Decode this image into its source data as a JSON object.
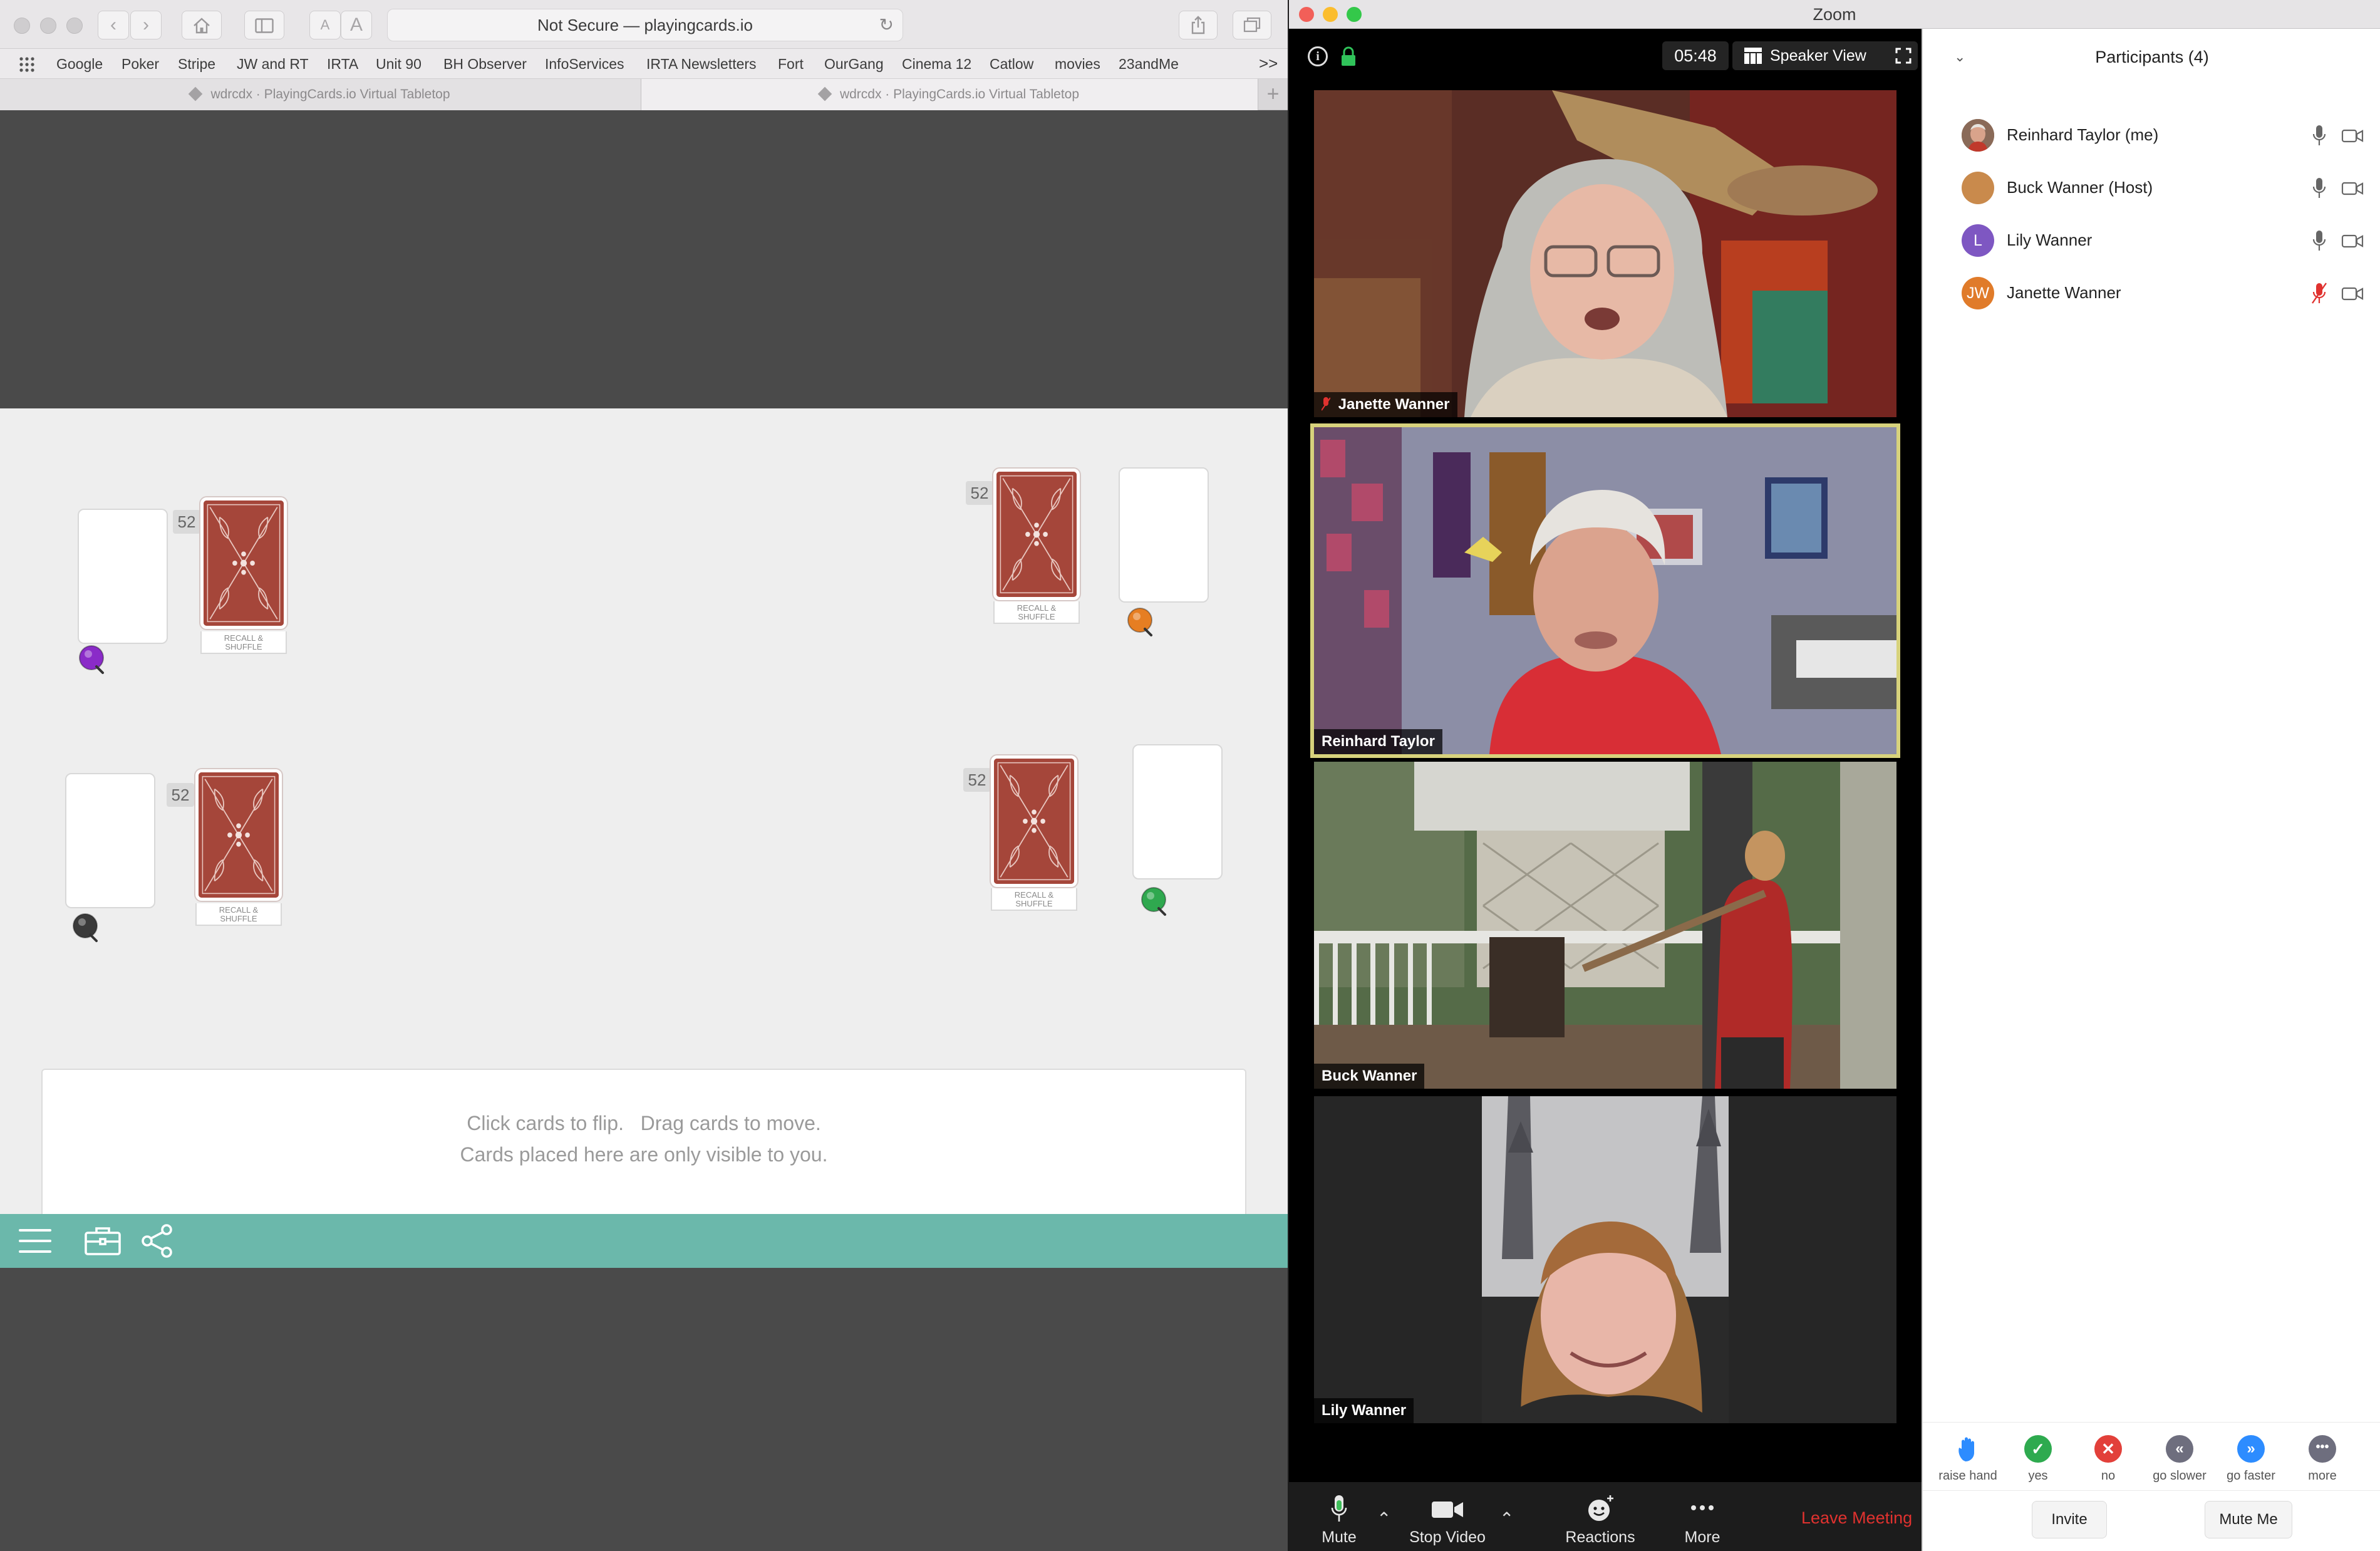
{
  "safari": {
    "address": "Not Secure — playingcards.io",
    "bookmarks": [
      "Google",
      "Poker",
      "Stripe",
      "JW and RT",
      "IRTA",
      "Unit 90",
      "BH Observer",
      "InfoServices",
      "IRTA Newsletters",
      "Fort",
      "OurGang",
      "Cinema 12",
      "Catlow",
      "movies",
      "23andMe"
    ],
    "more_bookmarks": ">>",
    "tabs": [
      {
        "label": "wdrcdx · PlayingCards.io Virtual Tabletop"
      },
      {
        "label": "wdrcdx · PlayingCards.io Virtual Tabletop"
      }
    ],
    "new_tab": "+"
  },
  "tabletop": {
    "decks": [
      {
        "count": "52",
        "recall_line1": "RECALL &",
        "recall_line2": "SHUFFLE"
      },
      {
        "count": "52",
        "recall_line1": "RECALL &",
        "recall_line2": "SHUFFLE"
      },
      {
        "count": "52",
        "recall_line1": "RECALL &",
        "recall_line2": "SHUFFLE"
      },
      {
        "count": "52",
        "recall_line1": "RECALL &",
        "recall_line2": "SHUFFLE"
      }
    ],
    "player_colors": {
      "purple": "#8a2bc8",
      "orange": "#e67e22",
      "dark": "#3a3a3a",
      "green": "#2fa84f"
    },
    "card_back_color": "#a5463a",
    "hand_line1": "Click cards to flip.   Drag cards to move.",
    "hand_line2": "Cards placed here are only visible to you.",
    "toolbar_color": "#6bb8ab"
  },
  "zoom": {
    "window_title": "Zoom",
    "timer": "05:48",
    "view_label": "Speaker View",
    "tiles": [
      {
        "name": "Janette Wanner",
        "muted": true
      },
      {
        "name": "Reinhard Taylor",
        "active": true
      },
      {
        "name": "Buck Wanner"
      },
      {
        "name": "Lily Wanner"
      }
    ],
    "controls": {
      "mute": "Mute",
      "stop_video": "Stop Video",
      "reactions": "Reactions",
      "more": "More",
      "leave": "Leave Meeting"
    },
    "participants_title": "Participants (4)",
    "participants": [
      {
        "name": "Reinhard Taylor (me)",
        "initials": "",
        "avatar_color": "#9a6a4e",
        "mic_muted": false
      },
      {
        "name": "Buck Wanner (Host)",
        "initials": "",
        "avatar_color": "#c98a4c",
        "mic_muted": false
      },
      {
        "name": "Lily Wanner",
        "initials": "L",
        "avatar_color": "#7e57c2",
        "mic_muted": false
      },
      {
        "name": "Janette Wanner",
        "initials": "JW",
        "avatar_color": "#e07b2a",
        "mic_muted": true
      }
    ],
    "reactions": [
      {
        "label": "raise hand",
        "color": "#2d8cff"
      },
      {
        "label": "yes",
        "color": "#2eaa4f"
      },
      {
        "label": "no",
        "color": "#e2403a"
      },
      {
        "label": "go slower",
        "color": "#6e6e7e"
      },
      {
        "label": "go faster",
        "color": "#2d8cff"
      },
      {
        "label": "more",
        "color": "#6e6e7e"
      }
    ],
    "invite": "Invite",
    "mute_me": "Mute Me",
    "active_speaker_color": "#d7d27c",
    "leave_color": "#e0322f"
  }
}
